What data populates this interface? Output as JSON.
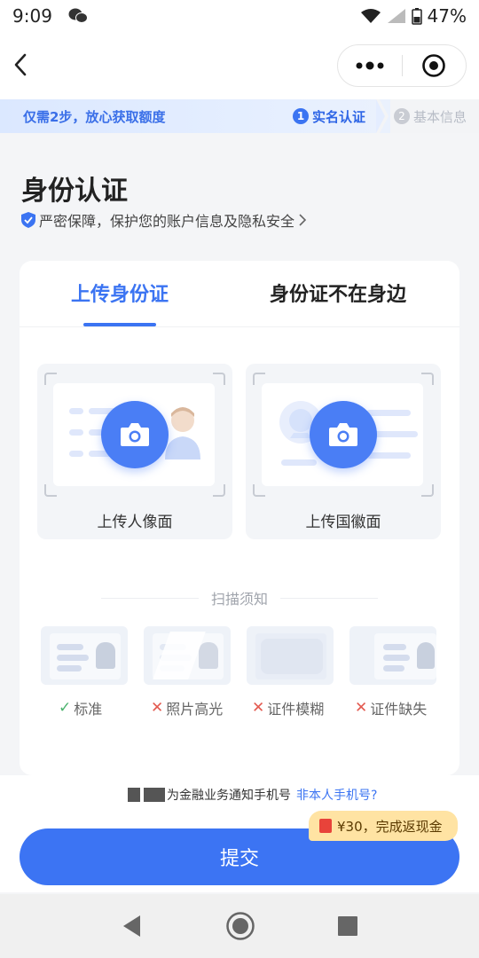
{
  "status_bar": {
    "time": "9:09",
    "battery": "47%"
  },
  "progress": {
    "tagline": "仅需2步，放心获取额度",
    "steps": [
      {
        "num": "1",
        "label": "实名认证"
      },
      {
        "num": "2",
        "label": "基本信息"
      }
    ]
  },
  "page": {
    "title": "身份认证",
    "privacy_note": "严密保障，保护您的账户信息及隐私安全"
  },
  "tabs": [
    {
      "label": "上传身份证"
    },
    {
      "label": "身份证不在身边"
    }
  ],
  "upload": {
    "front_label": "上传人像面",
    "back_label": "上传国徽面"
  },
  "scan": {
    "title": "扫描须知",
    "examples": [
      {
        "label": "标准",
        "mark": "✓"
      },
      {
        "label": "照片高光",
        "mark": "✕"
      },
      {
        "label": "证件模糊",
        "mark": "✕"
      },
      {
        "label": "证件缺失",
        "mark": "✕"
      }
    ]
  },
  "bottom": {
    "phone_note": "为金融业务通知手机号",
    "phone_link": "非本人手机号?",
    "cashback": "¥30，完成返现金",
    "submit": "提交"
  },
  "colors": {
    "accent": "#3b74f2",
    "ok": "#4cb36e",
    "bad": "#e35a50",
    "cashback_bg": "#ffe3a3"
  }
}
